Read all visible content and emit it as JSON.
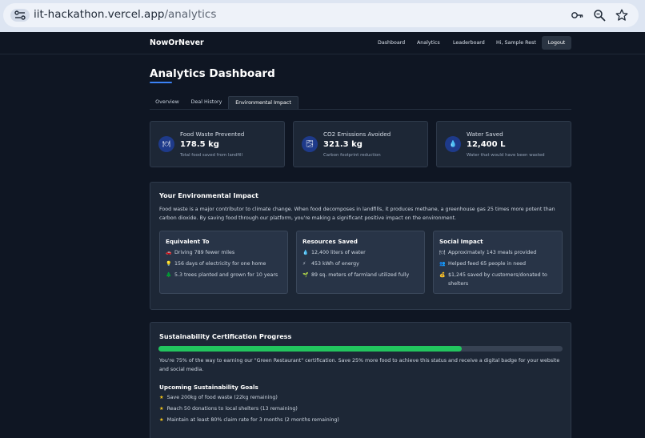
{
  "browser": {
    "url_host": "iit-hackathon.vercel.app",
    "url_path": "/analytics"
  },
  "navbar": {
    "brand": "NowOrNever",
    "links": [
      "Dashboard",
      "Analytics",
      "Leaderboard"
    ],
    "greeting": "Hi, Sample Rest",
    "logout": "Logout"
  },
  "page": {
    "title": "Analytics Dashboard",
    "tabs": [
      "Overview",
      "Deal History",
      "Environmental Impact"
    ],
    "active_tab": "Environmental Impact"
  },
  "stats": [
    {
      "icon": "🍽",
      "label": "Food Waste Prevented",
      "value": "178.5 kg",
      "sub": "Total food saved from landfill"
    },
    {
      "icon": "🌫",
      "label": "CO2 Emissions Avoided",
      "value": "321.3 kg",
      "sub": "Carbon footprint reduction"
    },
    {
      "icon": "💧",
      "label": "Water Saved",
      "value": "12,400 L",
      "sub": "Water that would have been wasted"
    }
  ],
  "impact": {
    "title": "Your Environmental Impact",
    "text": "Food waste is a major contributor to climate change. When food decomposes in landfills, it produces methane, a greenhouse gas 25 times more potent than carbon dioxide. By saving food through our platform, you're making a significant positive impact on the environment.",
    "cards": [
      {
        "title": "Equivalent To",
        "items": [
          {
            "icon": "🚗",
            "text": "Driving 789 fewer miles"
          },
          {
            "icon": "💡",
            "text": "156 days of electricity for one home"
          },
          {
            "icon": "🌲",
            "text": "5.3 trees planted and grown for 10 years"
          }
        ]
      },
      {
        "title": "Resources Saved",
        "items": [
          {
            "icon": "💧",
            "text": "12,400 liters of water"
          },
          {
            "icon": "⚡",
            "text": "453 kWh of energy"
          },
          {
            "icon": "🌱",
            "text": "89 sq. meters of farmland utilized fully"
          }
        ]
      },
      {
        "title": "Social Impact",
        "items": [
          {
            "icon": "🍽",
            "text": "Approximately 143 meals provided"
          },
          {
            "icon": "👥",
            "text": "Helped feed 65 people in need"
          },
          {
            "icon": "💰",
            "text": "$1,245 saved by customers/donated to shelters"
          }
        ]
      }
    ]
  },
  "certification": {
    "title": "Sustainability Certification Progress",
    "progress": 75,
    "text": "You're 75% of the way to earning our \"Green Restaurant\" certification. Save 25% more food to achieve this status and receive a digital badge for your website and social media.",
    "goals_title": "Upcoming Sustainability Goals",
    "goals": [
      "Save 200kg of food waste (22kg remaining)",
      "Reach 50 donations to local shelters (13 remaining)",
      "Maintain at least 80% claim rate for 3 months (2 months remaining)"
    ]
  },
  "colors": {
    "accent": "#3b82f6",
    "progress": "#22c55e",
    "star": "#f5c518"
  }
}
